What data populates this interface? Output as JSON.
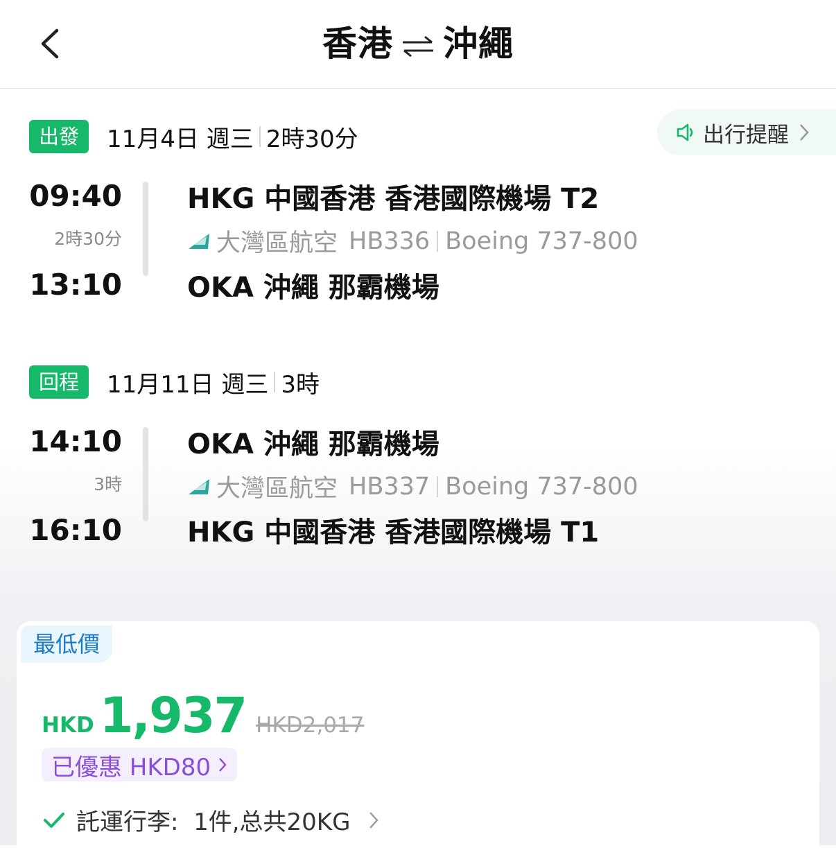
{
  "header": {
    "origin": "香港",
    "destination": "沖繩"
  },
  "reminder": {
    "label": "出行提醒"
  },
  "outbound": {
    "tag": "出發",
    "date": "11月4日 週三",
    "duration_total": "2時30分",
    "depart_time": "09:40",
    "segment_duration": "2時30分",
    "arrive_time": "13:10",
    "depart_airport": "HKG 中國香港 香港國際機場 T2",
    "arrive_airport": "OKA 沖繩 那霸機場",
    "airline": "大灣區航空",
    "flight_no": "HB336",
    "aircraft": "Boeing 737-800"
  },
  "inbound": {
    "tag": "回程",
    "date": "11月11日 週三",
    "duration_total": "3時",
    "depart_time": "14:10",
    "segment_duration": "3時",
    "arrive_time": "16:10",
    "depart_airport": "OKA 沖繩 那霸機場",
    "arrive_airport": "HKG 中國香港 香港國際機場 T1",
    "airline": "大灣區航空",
    "flight_no": "HB337",
    "aircraft": "Boeing 737-800"
  },
  "price": {
    "badge": "最低價",
    "currency": "HKD",
    "amount": "1,937",
    "original": "HKD2,017",
    "discount": "已優惠 HKD80",
    "baggage": "託運行李:  1件,总共20KG"
  },
  "colors": {
    "accent_green": "#16b86a",
    "discount_purple": "#8a4fd8",
    "badge_blue": "#1f7ac6"
  },
  "icons": [
    "back-arrow-icon",
    "swap-arrows-icon",
    "speaker-icon",
    "chevron-right-icon",
    "airline-logo-icon",
    "check-icon"
  ]
}
